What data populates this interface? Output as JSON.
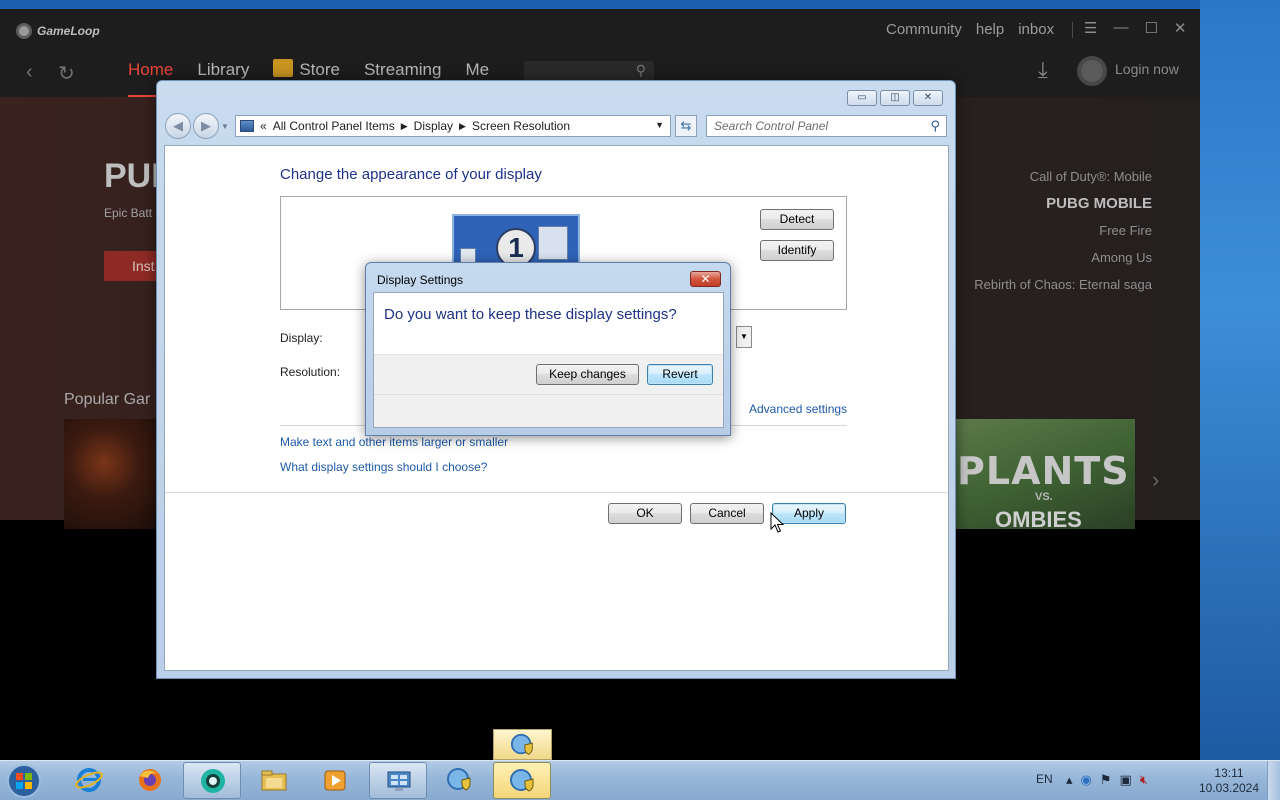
{
  "gameloop": {
    "logo_text": "GameLoop",
    "top_links": [
      "Community",
      "help",
      "inbox"
    ],
    "window_controls": [
      "☰",
      "—",
      "☐",
      "✕"
    ],
    "nav_back": "‹",
    "nav_refresh": "↻",
    "tabs": [
      {
        "label": "Home",
        "active": true
      },
      {
        "label": "Library",
        "active": false
      },
      {
        "label": "Store",
        "active": false
      },
      {
        "label": "Streaming",
        "active": false
      },
      {
        "label": "Me",
        "active": false
      }
    ],
    "login_label": "Login now",
    "hero_title": "PUB",
    "hero_subtitle": "Epic Batt",
    "install_label": "Inst",
    "game_list": [
      "Call of Duty®: Mobile",
      "PUBG MOBILE",
      "Free Fire",
      "Among Us",
      "Rebirth of Chaos: Eternal saga"
    ],
    "selected_game": "PUBG MOBILE",
    "popular_label": "Popular Gar",
    "pvz_text": "PLANTS",
    "pvz_vs": "VS.",
    "pvz_bottom": "OMBIES"
  },
  "control_panel": {
    "window_controls": [
      "▭",
      "◫",
      "✕"
    ],
    "breadcrumb_prefix": "«",
    "breadcrumb": [
      "All Control Panel Items",
      "Display",
      "Screen Resolution"
    ],
    "search_placeholder": "Search Control Panel",
    "heading": "Change the appearance of your display",
    "monitor_number": "1",
    "detect_label": "Detect",
    "identify_label": "Identify",
    "display_label": "Display:",
    "resolution_label": "Resolution:",
    "advanced_link": "Advanced settings",
    "link_text_size": "Make text and other items larger or smaller",
    "link_which_settings": "What display settings should I choose?",
    "ok_label": "OK",
    "cancel_label": "Cancel",
    "apply_label": "Apply"
  },
  "dialog": {
    "title": "Display Settings",
    "question": "Do you want to keep these display settings?",
    "keep_label": "Keep changes",
    "revert_label": "Revert",
    "close_glyph": "✕"
  },
  "taskbar": {
    "language": "EN",
    "time": "13:11",
    "date": "10.03.2024",
    "tray_icons": [
      "tray-up-arrow-icon",
      "network-browser-icon",
      "action-center-flag-icon",
      "display-icon",
      "volume-muted-icon"
    ],
    "pinned": [
      "internet-explorer-icon",
      "firefox-icon",
      "gameloop-icon",
      "file-explorer-icon",
      "media-player-icon",
      "control-panel-icon",
      "network-globe-icon",
      "network-globe-shield-icon"
    ]
  },
  "colors": {
    "gameloop_accent": "#e9463b",
    "win7_heading": "#1e3287",
    "win7_link": "#1e5aa8",
    "taskbar": "#98b7d9"
  }
}
